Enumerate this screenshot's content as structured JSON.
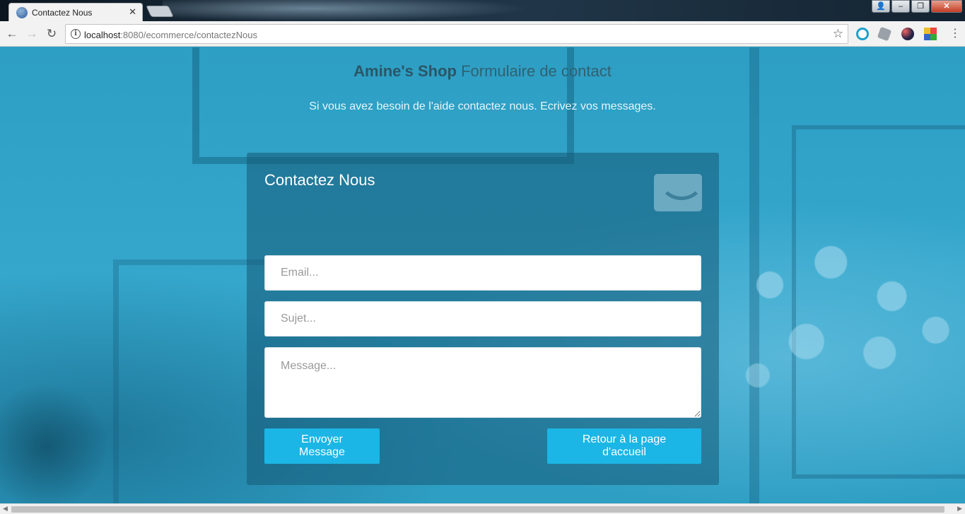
{
  "browser": {
    "tab_title": "Contactez Nous",
    "tab_close": "✕",
    "url_host": "localhost",
    "url_rest": ":8080/ecommerce/contactezNous",
    "window_buttons": {
      "user": "👤",
      "minimize": "–",
      "restore": "❐",
      "close": "✕"
    }
  },
  "header": {
    "brand": "Amine's Shop",
    "subtitle": "Formulaire de contact",
    "description": "Si vous avez besoin de l'aide contactez nous. Ecrivez vos messages."
  },
  "form": {
    "title": "Contactez Nous",
    "email_placeholder": "Email...",
    "email_value": "",
    "subject_placeholder": "Sujet...",
    "subject_value": "",
    "message_placeholder": "Message...",
    "message_value": "",
    "send_label": "Envoyer Message",
    "home_label": "Retour à la page d'accueil"
  },
  "icons": {
    "back": "back-arrow-icon",
    "forward": "forward-arrow-icon",
    "reload": "reload-icon",
    "info": "info-icon",
    "bookmark": "star-icon",
    "mail": "envelope-icon",
    "menu": "kebab-menu-icon"
  },
  "colors": {
    "accent_button": "#1bb6e5",
    "page_overlay": "#2f9fc4",
    "panel": "#165a76"
  }
}
